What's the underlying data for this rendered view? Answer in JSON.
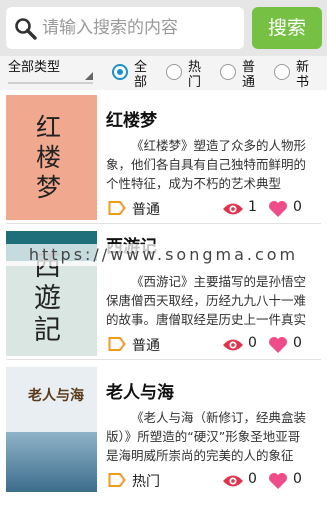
{
  "search": {
    "placeholder": "请输入搜索的内容",
    "button": "搜索"
  },
  "filter": {
    "type_select": "全部类型",
    "radios": [
      {
        "label": "全部",
        "checked": true
      },
      {
        "label": "热门",
        "checked": false
      },
      {
        "label": "普通",
        "checked": false
      },
      {
        "label": "新书",
        "checked": false
      }
    ]
  },
  "books": [
    {
      "title": "红楼梦",
      "desc": "《红楼梦》塑造了众多的人物形象，他们各自具有自己独特而鲜明的个性特征，成为不朽的艺术典型",
      "tag": "普通",
      "views": "1",
      "likes": "0",
      "cover_title": "红楼梦",
      "cover_color": "#f0a98f"
    },
    {
      "title": "西游记",
      "desc": "《西游记》主要描写的是孙悟空保唐僧西天取经，历经九九八十一难的故事。唐僧取经是历史上一件真实的事",
      "tag": "普通",
      "views": "0",
      "likes": "0",
      "cover_title": "西遊記",
      "cover_color": "#d9e6e1"
    },
    {
      "title": "老人与海",
      "desc": "《老人与海（新修订，经典盒装版）》所塑造的“硬汉”形象圣地亚哥是海明威所崇尚的完美的人的象征",
      "tag": "热门",
      "views": "0",
      "likes": "0",
      "cover_title": "老人与海",
      "cover_color": "#e8eef2"
    }
  ],
  "watermark": "https://www.songma.com",
  "colors": {
    "accent_green": "#76c043",
    "radio_blue": "#1e90c8",
    "tag_orange": "#f39a1e",
    "eye_red": "#e0334b",
    "heart_pink": "#ee4d8a"
  }
}
